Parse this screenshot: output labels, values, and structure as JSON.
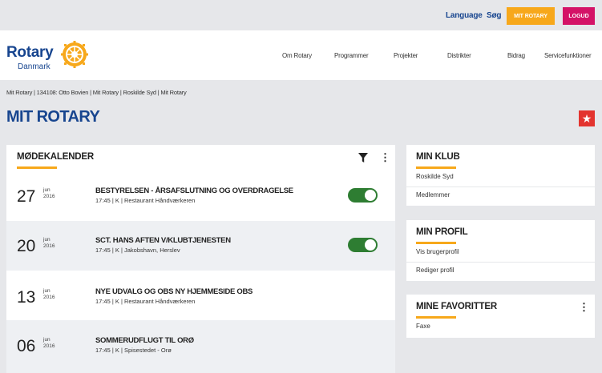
{
  "topbar": {
    "language": "Language",
    "search": "Søg",
    "mit_rotary": "MIT ROTARY",
    "logout": "LOGUD"
  },
  "header": {
    "logo_name": "Rotary",
    "logo_sub": "Danmark",
    "nav": [
      "Om Rotary",
      "Programmer",
      "Projekter",
      "Distrikter",
      "Bidrag",
      "Servicefunktioner"
    ]
  },
  "breadcrumb": "Mit Rotary  |  134108: Otto Bovien  |  Mit Rotary  |  Roskilde Syd  |  Mit Rotary",
  "page_title": "MIT ROTARY",
  "favorite_icon": "star-icon",
  "calendar": {
    "title": "MØDEKALENDER",
    "meetings": [
      {
        "day": "27",
        "month": "jun",
        "year": "2016",
        "title": "BESTYRELSEN - ÅRSAFSLUTNING OG OVERDRAGELSE",
        "meta": "17:45 | K | Restaurant Håndværkeren",
        "attending": true
      },
      {
        "day": "20",
        "month": "jun",
        "year": "2016",
        "title": "SCT. HANS AFTEN V/KLUBTJENESTEN",
        "meta": "17:45 | K | Jakobshavn, Herslev",
        "attending": true
      },
      {
        "day": "13",
        "month": "jun",
        "year": "2016",
        "title": "NYE UDVALG OG OBS NY HJEMMESIDE OBS",
        "meta": "17:45 | K | Restaurant Håndværkeren",
        "attending": false
      },
      {
        "day": "06",
        "month": "jun",
        "year": "2016",
        "title": "SOMMERUDFLUGT TIL ORØ",
        "meta": "17:45 | K | Spisestedet - Orø",
        "attending": false
      }
    ]
  },
  "min_klub": {
    "title": "MIN KLUB",
    "items": [
      "Roskilde Syd",
      "Medlemmer"
    ]
  },
  "min_profil": {
    "title": "MIN PROFIL",
    "items": [
      "Vis brugerprofil",
      "Rediger profil"
    ]
  },
  "mine_favoritter": {
    "title": "MINE FAVORITTER",
    "items": [
      "Faxe"
    ]
  },
  "colors": {
    "brand_blue": "#17458f",
    "gold": "#f7a81b",
    "cranberry": "#d41367",
    "toggle_green": "#2e7d32"
  }
}
